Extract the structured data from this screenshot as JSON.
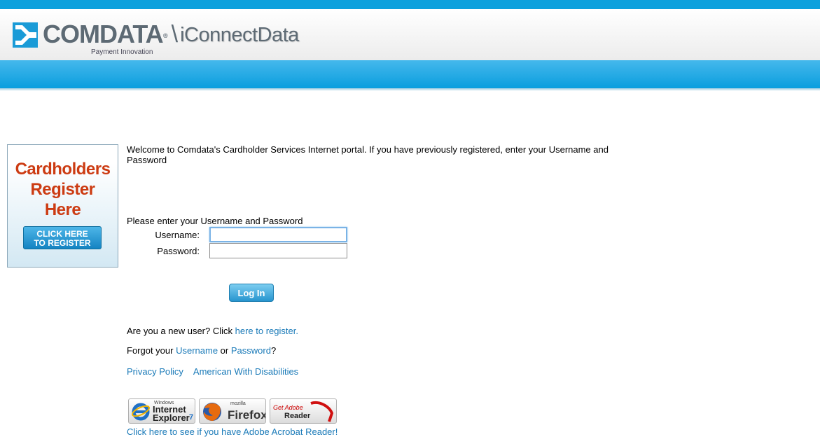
{
  "header": {
    "brand": "COMDATA",
    "trademark": "®",
    "tagline": "Payment Innovation",
    "divider": "\\",
    "product": "iConnectData",
    "colors": {
      "top_bar": "#0da1dd",
      "nav_bar": "#0a9ede",
      "brand_gray": "#5d6a74"
    }
  },
  "promo": {
    "title_lines": [
      "Cardholders",
      "Register",
      "Here"
    ],
    "button_lines": [
      "CLICK HERE",
      "TO REGISTER"
    ]
  },
  "welcome_text": "Welcome to Comdata's Cardholder Services Internet portal. If you have previously registered, enter your Username and Password",
  "login_form": {
    "prompt": "Please enter your Username and Password",
    "username_label": "Username:",
    "password_label": "Password:",
    "username_value": "",
    "password_value": "",
    "login_button": "Log In"
  },
  "links": {
    "new_user_prefix": "Are you a new user? Click ",
    "register_link": "here to register.",
    "forgot_prefix": "Forgot your ",
    "forgot_username": "Username",
    "forgot_or": " or ",
    "forgot_password": "Password",
    "forgot_suffix": "?",
    "privacy_policy": "Privacy Policy",
    "ada": "American With Disabilities",
    "acrobat_check": "Click here to see if you have Adobe Acrobat Reader!"
  },
  "badges": {
    "ie": {
      "small": "Windows",
      "line1": "Internet",
      "line2": "Explorer",
      "version": "7",
      "icon": "internet-explorer-logo"
    },
    "firefox": {
      "small": "mozilla",
      "name": "Firefox",
      "icon": "firefox-logo"
    },
    "adobe": {
      "get": "Get Adobe",
      "name": "Reader",
      "icon": "adobe-reader-logo"
    }
  }
}
